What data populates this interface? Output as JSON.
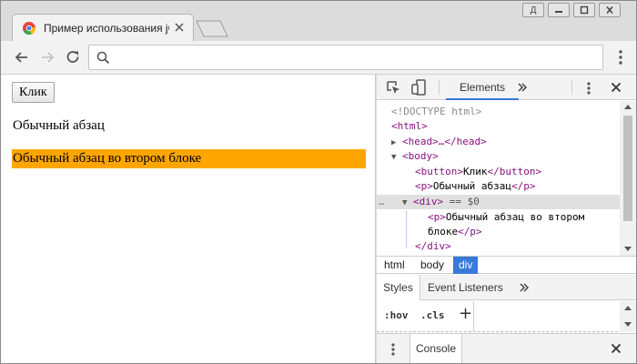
{
  "browser": {
    "tab": {
      "title": "Пример использования jQuery",
      "favicon": "chrome-icon"
    },
    "window_controls": {
      "profile_label": "Д"
    },
    "toolbar": {
      "address": {
        "value": "",
        "placeholder": ""
      }
    }
  },
  "page": {
    "button_label": "Клик",
    "paragraph_1": "Обычный абзац",
    "paragraph_2": "Обычный абзац во втором блоке",
    "highlight_color": "#ffa500"
  },
  "devtools": {
    "active_tab": "Elements",
    "more_tabs_icon": "chevron-double-right-icon",
    "tree": {
      "doctype": "<!DOCTYPE html>",
      "html_open": "<html>",
      "head_line": "<head>…</head>",
      "body_open": "<body>",
      "button_open": "<button>",
      "button_text": "Клик",
      "button_close": "</button>",
      "p_open": "<p>",
      "p1_text": "Обычный абзац",
      "p_close": "</p>",
      "div_open": "<div>",
      "selected_marker": " == $0",
      "p2_text_a": "Обычный абзац во втором",
      "p2_text_b": "блоке",
      "div_close": "</div>",
      "ellipsis": "…"
    },
    "breadcrumbs": [
      {
        "label": "html"
      },
      {
        "label": "body"
      },
      {
        "label": "div"
      }
    ],
    "styles": {
      "tabs": [
        "Styles",
        "Event Listeners"
      ],
      "hov_label": ":hov",
      "cls_label": ".cls",
      "add_label": "+"
    },
    "drawer": {
      "console_label": "Console"
    },
    "accent_color": "#3879d9"
  }
}
